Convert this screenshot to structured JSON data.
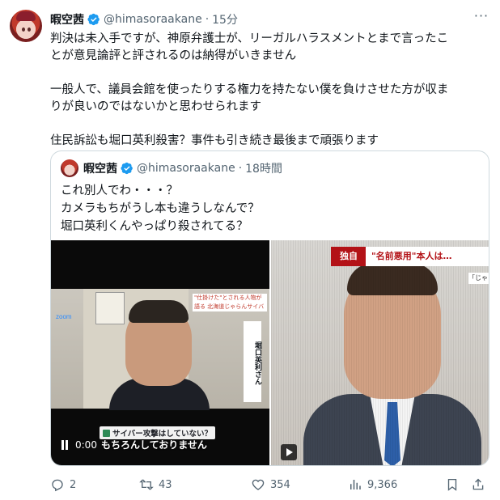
{
  "tweet": {
    "display_name": "暇空茜",
    "handle": "@himasoraakane",
    "separator": "·",
    "time": "15分",
    "more": "···",
    "lines": [
      "判決は未入手ですが、神原弁護士が、リーガルハラスメントとまで言ったこ",
      "とが意見論評と評されるのは納得がいきません",
      "",
      "一般人で、議員会館を使ったりする権力を持たない僕を負けさせた方が収ま",
      "りが良いのではないかと思わせられます",
      "",
      "住民訴訟も堀口英利殺害？事件も引き続き最後まで頑張ります"
    ]
  },
  "quote": {
    "display_name": "暇空茜",
    "handle": "@himasoraakane",
    "separator": "·",
    "time": "18時間",
    "lines": [
      "これ別人でわ・・・？",
      "カメラもちがうし本も違うしなんで？",
      "堀口英利くんやっぱり殺されてる？"
    ],
    "video1": {
      "top_caption": "\"仕掛けた\"とされる人物が語る 北海道じゃらんサイバー攻撃か",
      "zoom_label": "zoom",
      "side_caption": "堀口英利さん",
      "subtitle_question": "サイバー攻撃はしていない？",
      "subtitle_answer": "もちろんしておりません",
      "elapsed": "0:00"
    },
    "video2": {
      "tag": "独自",
      "headline": "\"名前悪用\"本人は…",
      "sub": "「じゃ"
    }
  },
  "actions": {
    "replies": "2",
    "reposts": "43",
    "likes": "354",
    "views": "9,366"
  },
  "colors": {
    "text": "#0f1419",
    "muted": "#536471",
    "border": "#cfd9de",
    "verified": "#1d9bf0"
  }
}
